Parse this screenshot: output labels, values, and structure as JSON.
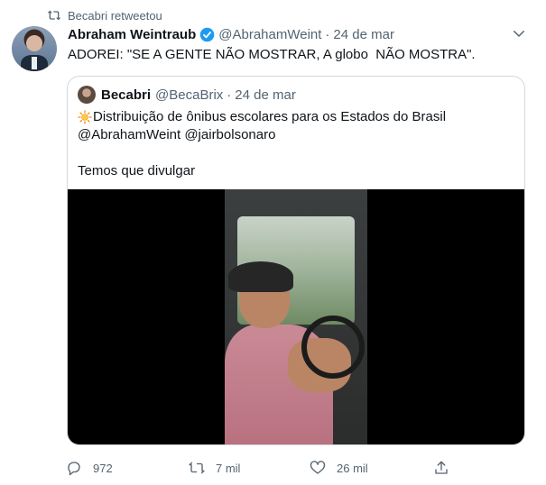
{
  "retweet_context": {
    "label": "Becabri retweetou"
  },
  "tweet": {
    "author_name": "Abraham Weintraub",
    "handle": "@AbrahamWeint",
    "separator": "·",
    "date": "24 de mar",
    "text": "ADOREI: \"SE A GENTE NÃO MOSTRAR, A globo  NÃO MOSTRA\"."
  },
  "quoted_tweet": {
    "author_name": "Becabri",
    "handle": "@BecaBrix",
    "separator": "·",
    "date": "24 de mar",
    "lines": [
      "Distribuição de ônibus escolares para os Estados do Brasil",
      "@AbrahamWeint @jairbolsonaro",
      "",
      "Temos que divulgar"
    ]
  },
  "actions": {
    "replies": "972",
    "retweets": "7 mil",
    "likes": "26 mil"
  },
  "colors": {
    "text": "#0f1419",
    "secondary": "#536471",
    "verified": "#1d9bf0",
    "border": "#cfd9de"
  }
}
